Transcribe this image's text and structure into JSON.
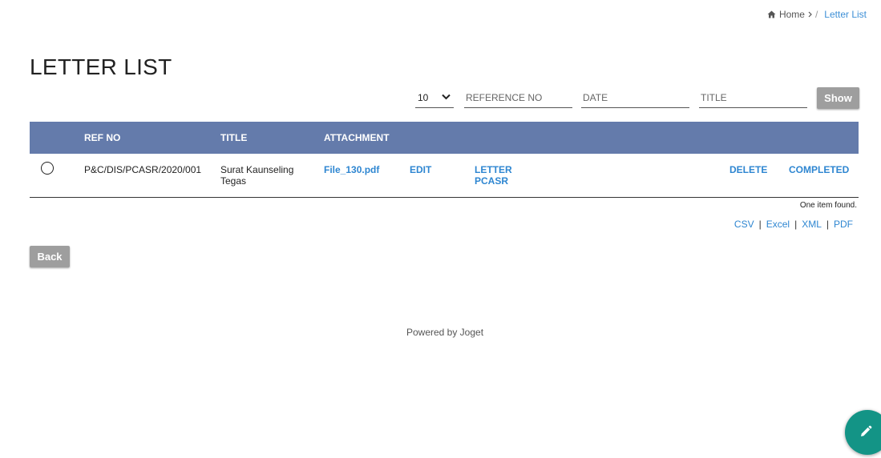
{
  "breadcrumb": {
    "home_label": "Home",
    "separator": "/",
    "current_label": "Letter List"
  },
  "page": {
    "title": "LETTER LIST"
  },
  "filters": {
    "page_size": "10",
    "ref_placeholder": "REFERENCE NO",
    "date_placeholder": "DATE",
    "title_placeholder": "TITLE",
    "show_label": "Show"
  },
  "table": {
    "headers": {
      "ref_no": "REF NO",
      "title": "TITLE",
      "attachment": "ATTACHMENT"
    },
    "rows": [
      {
        "ref_no": "P&C/DIS/PCASR/2020/001",
        "title_line1": "Surat Kaunseling",
        "title_line2": "Tegas",
        "attachment": "File_130.pdf",
        "edit": "EDIT",
        "letter_line1": "LETTER",
        "letter_line2": "PCASR",
        "delete": "DELETE",
        "completed": "COMPLETED"
      }
    ],
    "found_text": "One item found."
  },
  "exports": {
    "csv": "CSV",
    "excel": "Excel",
    "xml": "XML",
    "pdf": "PDF",
    "separator": "|"
  },
  "back_label": "Back",
  "footer": {
    "text": "Powered by Joget"
  },
  "colors": {
    "header_bg": "#647bab",
    "link": "#2e86d1",
    "button_bg": "#9e9e9e",
    "fab_bg": "#139486"
  },
  "icons": {
    "home": "home-icon",
    "dropdown": "chevron-down-icon",
    "fab": "pencil-icon"
  }
}
